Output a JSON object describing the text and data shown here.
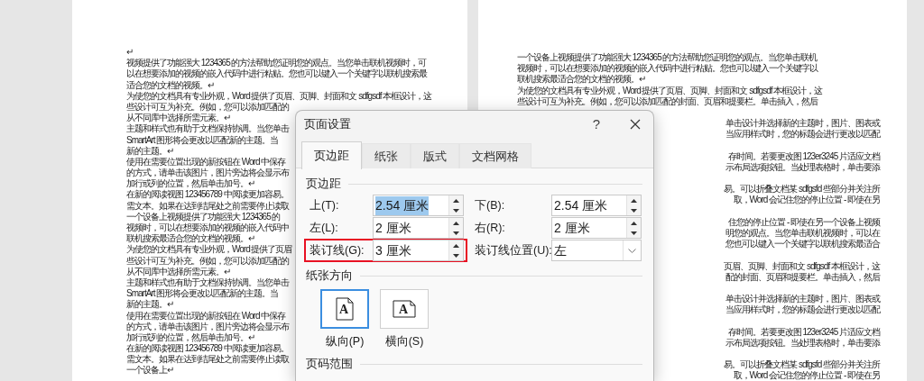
{
  "left_page": {
    "lines": [
      "↵",
      "视频提供了功能强大 1234365 的方法帮助您证明您的观点。当您单击联机视频时，可",
      "以在想要添加的视频的嵌入代码中进行粘贴。您也可以键入一个关键字以联机搜索最",
      "适合您的文档的视频。↵",
      "为使您的文档具有专业外观，Word 提供了页眉、页脚、封面和文 sdfgsdf 本框设计，这",
      "些设计可互为补充。例如，您可以添加匹配的",
      "从不同库中选择所需元素。↵",
      "主题和样式也有助于文档保持协调。当您单击",
      "SmartArt 图形将会更改以匹配新的主题。当",
      "新的主题。↵",
      "使用在需要位置出现的新按钮在 Word 中保存",
      "的方式，请单击该图片，图片旁边将会显示布",
      "加行或列的位置，然后单击加号。↵",
      "在新的阅读视图 123456789 中阅读更加容易。",
      "需文本。如果在达到结尾处之前需要停止读取",
      "一个设备上视频提供了功能强大 1234365 的",
      "视频时，可以在想要添加的视频的嵌入代码中",
      "联机搜索最适合您的文档的视频。↵",
      "为使您的文档具有专业外观，Word 提供了页眉",
      "些设计可互为补充。例如，您可以添加匹配的",
      "从不同库中选择所需元素。↵",
      "主题和样式也有助于文档保持协调。当您单击",
      "SmartArt 图形将会更改以匹配新的主题。当",
      "新的主题。↵",
      "使用在需要位置出现的新按钮在 Word 中保存",
      "的方式，请单击该图片，图片旁边将会显示布",
      "加行或列的位置，然后单击加号。↵",
      "在新的阅读视图 123456789 中阅读更加容易。",
      "需文本。如果在达到结尾处之前需要停止读取",
      "一个设备上↵"
    ]
  },
  "right_page": {
    "paragraphs": [
      {
        "kind": "full",
        "lines": [
          "一个设备上视频提供了功能强大 1234365 的方法帮助您证明您的观点。当您单击联机",
          "视频时，可以在想要添加的视频的嵌入代码中进行粘贴。您也可以键入一个关键字以",
          "联机搜索最适合您的文档的视频。↵",
          "为使您的文档具有专业外观，Word 提供了页眉、页脚、封面和文 sdfgsdf 本框设计，这",
          "些设计可互为补充。例如，您可以添加匹配的封面、页眉和提要栏。单击插入，然后"
        ]
      },
      {
        "kind": "cut",
        "lines": [
          "单击设计并选择新的主题时，图片、图表或",
          "当应用样式时，您的标题会进行更改以匹配"
        ]
      },
      {
        "kind": "cut",
        "lines": [
          "存时间。若要更改图 123er3245 片适应文档",
          "示布局选项按钮。当处理表格时，单击要添"
        ]
      },
      {
        "kind": "cut",
        "lines": [
          "易。可以折叠文档某 sdfgsfd 些部分并关注所",
          "取，Word 会记住您的停止位置 - 即使在另"
        ]
      },
      {
        "kind": "cut",
        "lines": [
          "住您的停止位置 - 即使在另一个设备上视频",
          "明您的观点。当您单击联机视频时，可以在",
          "您也可以键入一个关键字以联机搜索最适合"
        ]
      },
      {
        "kind": "cut",
        "lines": [
          "页眉、页脚、封面和文 sdfgsdf 本框设计，这",
          "配的封面、页眉和提要栏。单击插入，然后"
        ]
      },
      {
        "kind": "cut",
        "lines": [
          "单击设计并选择新的主题时，图片、图表或",
          "当应用样式时，您的标题会进行更改以匹配"
        ]
      },
      {
        "kind": "cut",
        "lines": [
          "存时间。若要更改图 123er3245 片适应文档",
          "示布局选项按钮。当处理表格时，单击要添"
        ]
      },
      {
        "kind": "cut",
        "lines": [
          "易。可以折叠文档某 sdfgsfd 些部分并关注所",
          "取，Word 会记住您的停止位置 - 即使在另"
        ]
      }
    ]
  },
  "dialog": {
    "title": "页面设置",
    "help": "?",
    "tabs": [
      {
        "label": "页边距",
        "selected": true
      },
      {
        "label": "纸张",
        "selected": false
      },
      {
        "label": "版式",
        "selected": false
      },
      {
        "label": "文档网格",
        "selected": false
      }
    ],
    "sections": [
      {
        "kind": "fields",
        "heading": "页边距",
        "fields": [
          {
            "kind": "spin",
            "label": "上(T):",
            "value": "2.54 厘米",
            "value_selected": true,
            "highlighted": false
          },
          {
            "kind": "spin",
            "label": "下(B):",
            "value": "2.54 厘米",
            "value_selected": false,
            "highlighted": false
          },
          {
            "kind": "spin",
            "label": "左(L):",
            "value": "2 厘米",
            "value_selected": false,
            "highlighted": false
          },
          {
            "kind": "spin",
            "label": "右(R):",
            "value": "2 厘米",
            "value_selected": false,
            "highlighted": false
          },
          {
            "kind": "spin",
            "label": "装订线(G):",
            "value": "3 厘米",
            "value_selected": false,
            "highlighted": true
          },
          {
            "kind": "dropdown",
            "label": "装订线位置(U):",
            "value": "左",
            "value_selected": false,
            "highlighted": false
          }
        ]
      },
      {
        "kind": "orientation",
        "heading": "纸张方向",
        "options": [
          {
            "kind": "portrait",
            "letter": "A",
            "label": "纵向(P)",
            "selected": true
          },
          {
            "kind": "landscape",
            "letter": "A",
            "label": "横向(S)",
            "selected": false
          }
        ]
      },
      {
        "kind": "heading",
        "heading": "页码范围"
      }
    ]
  }
}
